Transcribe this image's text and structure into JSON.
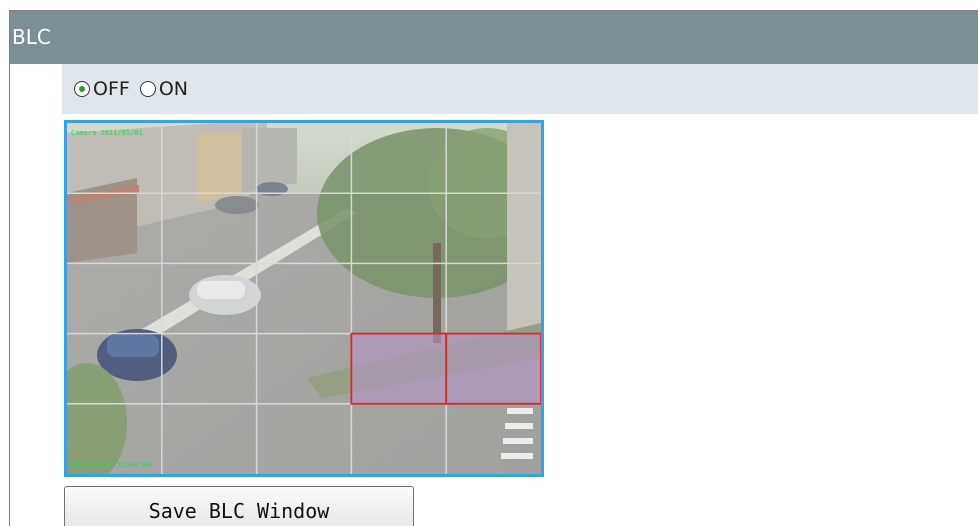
{
  "header": {
    "title": "BLC"
  },
  "options": {
    "off_label": "OFF",
    "on_label": "ON",
    "selected": "OFF"
  },
  "preview": {
    "grid_columns": 5,
    "grid_rows": 5,
    "selected_cells": [
      [
        3,
        3
      ],
      [
        4,
        3
      ]
    ],
    "border_color": "#33a2e6",
    "grid_color": "#d8d8d8",
    "selection_color": "#e0242c",
    "timestamp_top": "Camera 2011/01/01",
    "timestamp_bottom": "2011/01/01 12:00:00"
  },
  "actions": {
    "save_label": "Save BLC Window"
  }
}
